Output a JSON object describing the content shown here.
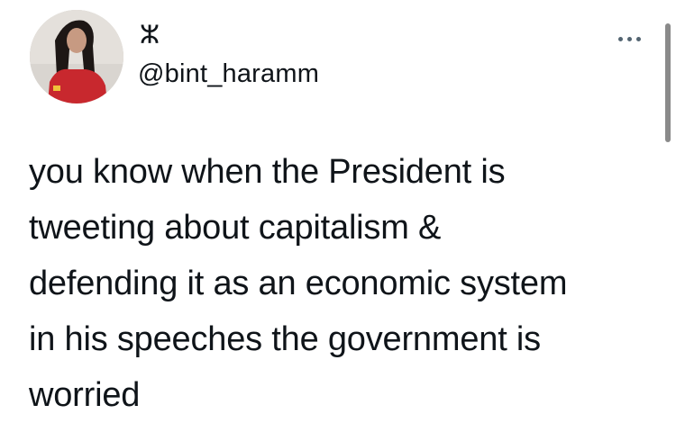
{
  "author": {
    "display_name": "ⵣ",
    "handle": "@bint_haramm",
    "avatar_icon": "user-avatar-photo"
  },
  "tweet": {
    "lines": [
      "you know when the President is",
      "tweeting about capitalism &",
      "defending it as an economic system",
      "in his speeches the government is",
      "worried"
    ]
  },
  "more_menu": {
    "icon": "more-horizontal-icon"
  },
  "colors": {
    "text": "#0f1419",
    "secondary": "#536471",
    "background": "#ffffff",
    "avatar_shirt": "#c8282e"
  }
}
